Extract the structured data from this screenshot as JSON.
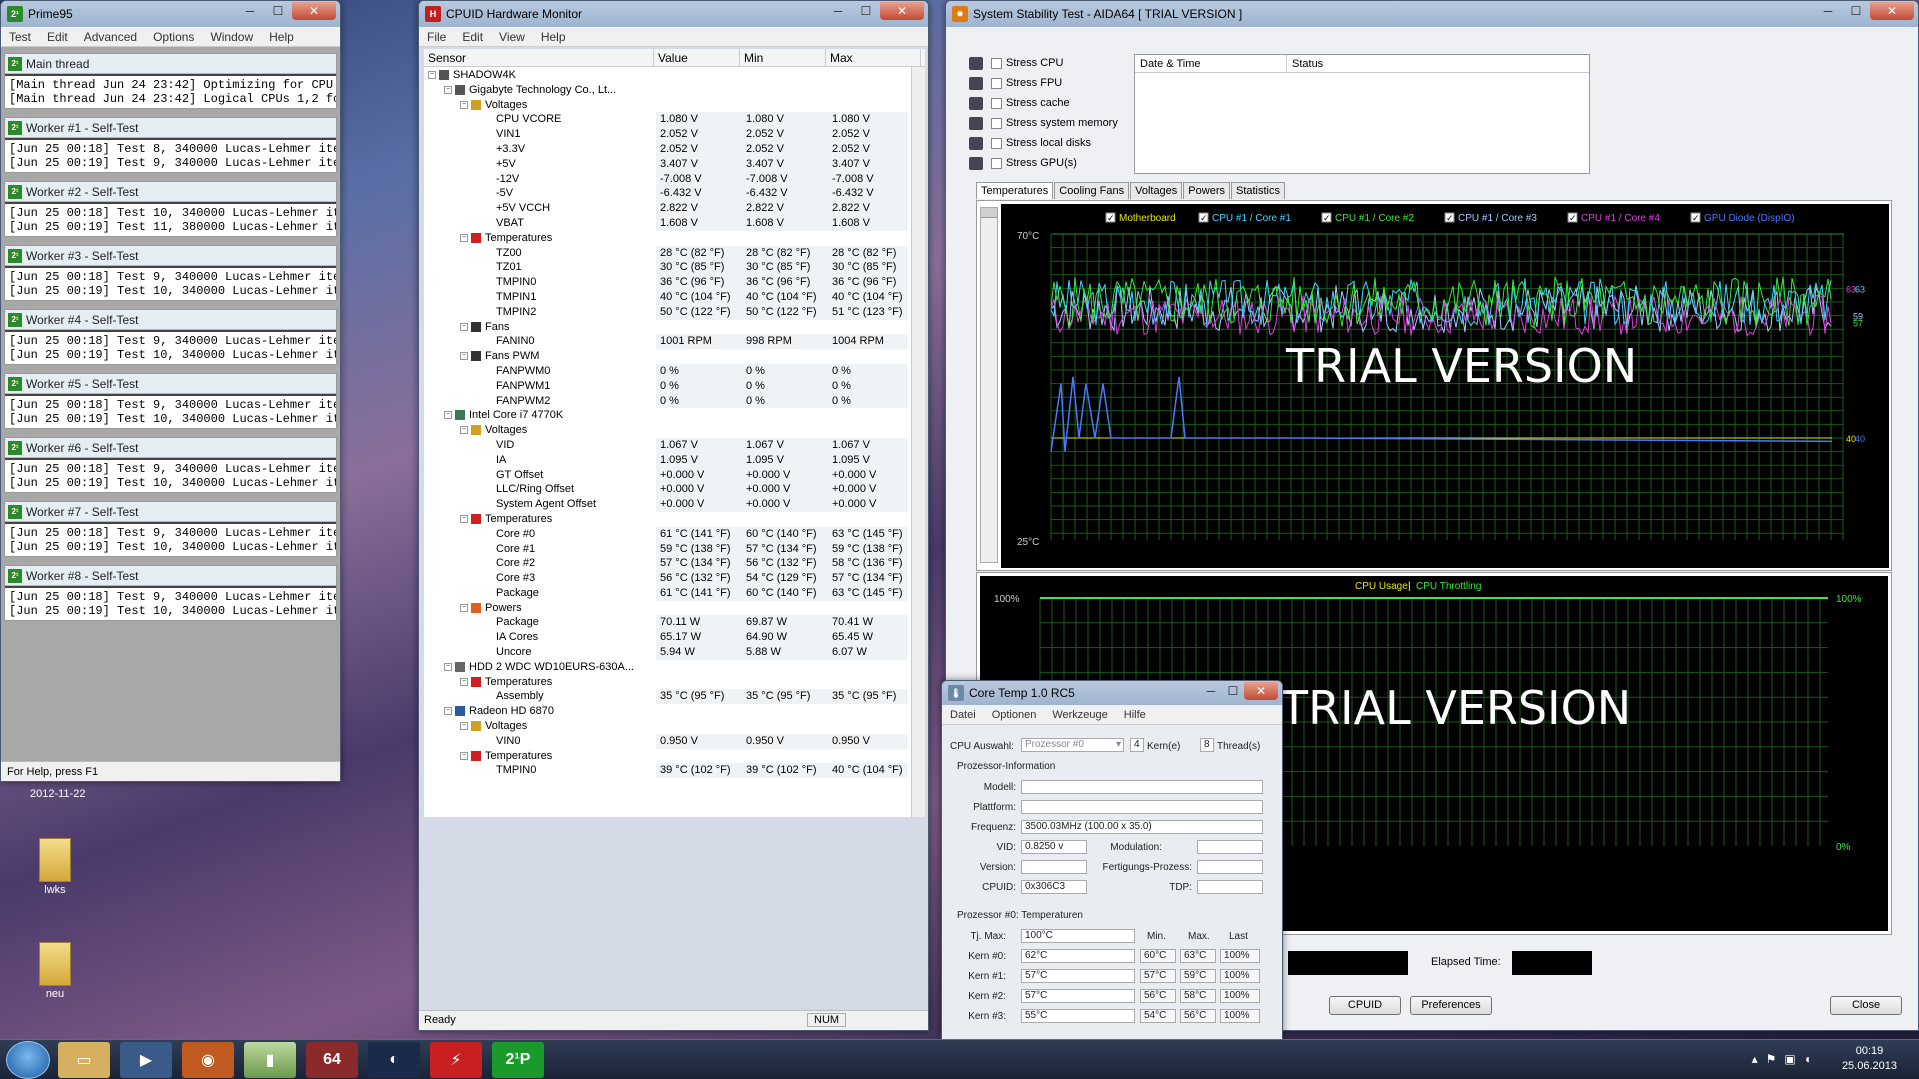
{
  "prime95": {
    "title": "Prime95",
    "menu": [
      "Test",
      "Edit",
      "Advanced",
      "Options",
      "Window",
      "Help"
    ],
    "main": {
      "title": "Main thread",
      "lines": [
        "[Main thread Jun 24 23:42] Optimizing for CPU architecture:",
        "[Main thread Jun 24 23:42] Logical CPUs 1,2 form one phys"
      ]
    },
    "workers": [
      {
        "title": "Worker #1 - Self-Test",
        "l1": "[Jun 25 00:18] Test 8, 340000 Lucas-Lehmer iterations of M",
        "l2": "[Jun 25 00:19] Test 9, 340000 Lucas-Lehmer iterations of M"
      },
      {
        "title": "Worker #2 - Self-Test",
        "l1": "[Jun 25 00:18] Test 10, 340000 Lucas-Lehmer iterations of",
        "l2": "[Jun 25 00:19] Test 11, 380000 Lucas-Lehmer iterations of"
      },
      {
        "title": "Worker #3 - Self-Test",
        "l1": "[Jun 25 00:18] Test 9, 340000 Lucas-Lehmer iterations of M",
        "l2": "[Jun 25 00:19] Test 10, 340000 Lucas-Lehmer iterations of"
      },
      {
        "title": "Worker #4 - Self-Test",
        "l1": "[Jun 25 00:18] Test 9, 340000 Lucas-Lehmer iterations of M",
        "l2": "[Jun 25 00:19] Test 10, 340000 Lucas-Lehmer iterations of"
      },
      {
        "title": "Worker #5 - Self-Test",
        "l1": "[Jun 25 00:18] Test 9, 340000 Lucas-Lehmer iterations of M",
        "l2": "[Jun 25 00:19] Test 10, 340000 Lucas-Lehmer iterations of"
      },
      {
        "title": "Worker #6 - Self-Test",
        "l1": "[Jun 25 00:18] Test 9, 340000 Lucas-Lehmer iterations of M",
        "l2": "[Jun 25 00:19] Test 10, 340000 Lucas-Lehmer iterations of"
      },
      {
        "title": "Worker #7 - Self-Test",
        "l1": "[Jun 25 00:18] Test 9, 340000 Lucas-Lehmer iterations of M",
        "l2": "[Jun 25 00:19] Test 10, 340000 Lucas-Lehmer iterations of"
      },
      {
        "title": "Worker #8 - Self-Test",
        "l1": "[Jun 25 00:18] Test 9, 340000 Lucas-Lehmer iterations of M",
        "l2": "[Jun 25 00:19] Test 10, 340000 Lucas-Lehmer iterations of"
      }
    ],
    "status": "For Help, press F1"
  },
  "hwmon": {
    "title": "CPUID Hardware Monitor",
    "menu": [
      "File",
      "Edit",
      "View",
      "Help"
    ],
    "columns": [
      "Sensor",
      "Value",
      "Min",
      "Max"
    ],
    "rows": [
      {
        "lv": 0,
        "t": "dev",
        "n": "SHADOW4K"
      },
      {
        "lv": 1,
        "t": "dev",
        "n": "Gigabyte Technology Co., Lt..."
      },
      {
        "lv": 2,
        "t": "volt",
        "n": "Voltages"
      },
      {
        "lv": 3,
        "n": "CPU VCORE",
        "v": "1.080 V",
        "mi": "1.080 V",
        "ma": "1.080 V"
      },
      {
        "lv": 3,
        "n": "VIN1",
        "v": "2.052 V",
        "mi": "2.052 V",
        "ma": "2.052 V"
      },
      {
        "lv": 3,
        "n": "+3.3V",
        "v": "2.052 V",
        "mi": "2.052 V",
        "ma": "2.052 V"
      },
      {
        "lv": 3,
        "n": "+5V",
        "v": "3.407 V",
        "mi": "3.407 V",
        "ma": "3.407 V"
      },
      {
        "lv": 3,
        "n": "-12V",
        "v": "-7.008 V",
        "mi": "-7.008 V",
        "ma": "-7.008 V"
      },
      {
        "lv": 3,
        "n": "-5V",
        "v": "-6.432 V",
        "mi": "-6.432 V",
        "ma": "-6.432 V"
      },
      {
        "lv": 3,
        "n": "+5V VCCH",
        "v": "2.822 V",
        "mi": "2.822 V",
        "ma": "2.822 V"
      },
      {
        "lv": 3,
        "n": "VBAT",
        "v": "1.608 V",
        "mi": "1.608 V",
        "ma": "1.608 V"
      },
      {
        "lv": 2,
        "t": "temp",
        "n": "Temperatures"
      },
      {
        "lv": 3,
        "n": "TZ00",
        "v": "28 °C (82 °F)",
        "mi": "28 °C (82 °F)",
        "ma": "28 °C (82 °F)"
      },
      {
        "lv": 3,
        "n": "TZ01",
        "v": "30 °C (85 °F)",
        "mi": "30 °C (85 °F)",
        "ma": "30 °C (85 °F)"
      },
      {
        "lv": 3,
        "n": "TMPIN0",
        "v": "36 °C (96 °F)",
        "mi": "36 °C (96 °F)",
        "ma": "36 °C (96 °F)"
      },
      {
        "lv": 3,
        "n": "TMPIN1",
        "v": "40 °C (104 °F)",
        "mi": "40 °C (104 °F)",
        "ma": "40 °C (104 °F)"
      },
      {
        "lv": 3,
        "n": "TMPIN2",
        "v": "50 °C (122 °F)",
        "mi": "50 °C (122 °F)",
        "ma": "51 °C (123 °F)"
      },
      {
        "lv": 2,
        "t": "fan",
        "n": "Fans"
      },
      {
        "lv": 3,
        "n": "FANIN0",
        "v": "1001 RPM",
        "mi": "998 RPM",
        "ma": "1004 RPM"
      },
      {
        "lv": 2,
        "t": "fan",
        "n": "Fans PWM"
      },
      {
        "lv": 3,
        "n": "FANPWM0",
        "v": "0 %",
        "mi": "0 %",
        "ma": "0 %"
      },
      {
        "lv": 3,
        "n": "FANPWM1",
        "v": "0 %",
        "mi": "0 %",
        "ma": "0 %"
      },
      {
        "lv": 3,
        "n": "FANPWM2",
        "v": "0 %",
        "mi": "0 %",
        "ma": "0 %"
      },
      {
        "lv": 1,
        "t": "chip",
        "n": "Intel Core i7 4770K"
      },
      {
        "lv": 2,
        "t": "volt",
        "n": "Voltages"
      },
      {
        "lv": 3,
        "n": "VID",
        "v": "1.067 V",
        "mi": "1.067 V",
        "ma": "1.067 V"
      },
      {
        "lv": 3,
        "n": "IA",
        "v": "1.095 V",
        "mi": "1.095 V",
        "ma": "1.095 V"
      },
      {
        "lv": 3,
        "n": "GT Offset",
        "v": "+0.000 V",
        "mi": "+0.000 V",
        "ma": "+0.000 V"
      },
      {
        "lv": 3,
        "n": "LLC/Ring Offset",
        "v": "+0.000 V",
        "mi": "+0.000 V",
        "ma": "+0.000 V"
      },
      {
        "lv": 3,
        "n": "System Agent Offset",
        "v": "+0.000 V",
        "mi": "+0.000 V",
        "ma": "+0.000 V"
      },
      {
        "lv": 2,
        "t": "temp",
        "n": "Temperatures"
      },
      {
        "lv": 3,
        "n": "Core #0",
        "v": "61 °C (141 °F)",
        "mi": "60 °C (140 °F)",
        "ma": "63 °C (145 °F)"
      },
      {
        "lv": 3,
        "n": "Core #1",
        "v": "59 °C (138 °F)",
        "mi": "57 °C (134 °F)",
        "ma": "59 °C (138 °F)"
      },
      {
        "lv": 3,
        "n": "Core #2",
        "v": "57 °C (134 °F)",
        "mi": "56 °C (132 °F)",
        "ma": "58 °C (136 °F)"
      },
      {
        "lv": 3,
        "n": "Core #3",
        "v": "56 °C (132 °F)",
        "mi": "54 °C (129 °F)",
        "ma": "57 °C (134 °F)"
      },
      {
        "lv": 3,
        "n": "Package",
        "v": "61 °C (141 °F)",
        "mi": "60 °C (140 °F)",
        "ma": "63 °C (145 °F)"
      },
      {
        "lv": 2,
        "t": "power",
        "n": "Powers"
      },
      {
        "lv": 3,
        "n": "Package",
        "v": "70.11 W",
        "mi": "69.87 W",
        "ma": "70.41 W"
      },
      {
        "lv": 3,
        "n": "IA Cores",
        "v": "65.17 W",
        "mi": "64.90 W",
        "ma": "65.45 W"
      },
      {
        "lv": 3,
        "n": "Uncore",
        "v": "5.94 W",
        "mi": "5.88 W",
        "ma": "6.07 W"
      },
      {
        "lv": 1,
        "t": "hdd",
        "n": "HDD 2 WDC WD10EURS-630A..."
      },
      {
        "lv": 2,
        "t": "temp",
        "n": "Temperatures"
      },
      {
        "lv": 3,
        "n": "Assembly",
        "v": "35 °C (95 °F)",
        "mi": "35 °C (95 °F)",
        "ma": "35 °C (95 °F)"
      },
      {
        "lv": 1,
        "t": "gpu",
        "n": "Radeon HD 6870"
      },
      {
        "lv": 2,
        "t": "volt",
        "n": "Voltages"
      },
      {
        "lv": 3,
        "n": "VIN0",
        "v": "0.950 V",
        "mi": "0.950 V",
        "ma": "0.950 V"
      },
      {
        "lv": 2,
        "t": "temp",
        "n": "Temperatures"
      },
      {
        "lv": 3,
        "n": "TMPIN0",
        "v": "39 °C (102 °F)",
        "mi": "39 °C (102 °F)",
        "ma": "40 °C (104 °F)"
      }
    ],
    "status": "Ready",
    "num": "NUM"
  },
  "aida": {
    "title": "System Stability Test - AIDA64  [ TRIAL VERSION ]",
    "stress": [
      "Stress CPU",
      "Stress FPU",
      "Stress cache",
      "Stress system memory",
      "Stress local disks",
      "Stress GPU(s)"
    ],
    "log_cols": [
      "Date & Time",
      "Status"
    ],
    "tabs": [
      "Temperatures",
      "Cooling Fans",
      "Voltages",
      "Powers",
      "Statistics"
    ],
    "legend": [
      {
        "name": "Motherboard",
        "color": "#e8e800"
      },
      {
        "name": "CPU #1 / Core #1",
        "color": "#48d2ff"
      },
      {
        "name": "CPU #1 / Core #2",
        "color": "#3ae83a"
      },
      {
        "name": "CPU #1 / Core #3",
        "color": "#a8c8ff"
      },
      {
        "name": "CPU #1 / Core #4",
        "color": "#e040e0"
      },
      {
        "name": "GPU Diode (DispIO)",
        "color": "#4a78ff"
      }
    ],
    "temp_top": "70°C",
    "temp_bottom": "25°C",
    "right_labels": [
      "63",
      "63",
      "59",
      "57",
      "40",
      "40"
    ],
    "watermark": "TRIAL VERSION",
    "usage_legend": [
      "CPU Usage",
      "CPU Throttling"
    ],
    "usage_sep": "|",
    "pct_top": "100%",
    "pct_bottom": "0%",
    "watermark2": "TRIAL VERSION",
    "elapsed_label": "Elapsed Time:",
    "buttons": [
      "CPUID",
      "Preferences",
      "Close"
    ]
  },
  "coretemp": {
    "title": "Core Temp 1.0 RC5",
    "menu": [
      "Datei",
      "Optionen",
      "Werkzeuge",
      "Hilfe"
    ],
    "cpu_sel_label": "CPU Auswahl:",
    "cpu_sel": "Prozessor #0",
    "cores": "4",
    "cores_label": "Kern(e)",
    "threads": "8",
    "threads_label": "Thread(s)",
    "info_title": "Prozessor-Information",
    "model_label": "Modell:",
    "platform_label": "Plattform:",
    "freq_label": "Frequenz:",
    "freq": "3500.03MHz (100.00 x 35.0)",
    "vid_label": "VID:",
    "vid": "0.8250 v",
    "modulation_label": "Modulation:",
    "version_label": "Version:",
    "fert_label": "Fertigungs-Prozess:",
    "cpuid_label": "CPUID:",
    "cpuid": "0x306C3",
    "tdp_label": "TDP:",
    "temp_title": "Prozessor #0: Temperaturen",
    "tjmax_label": "Tj. Max:",
    "tjmax": "100°C",
    "cols": [
      "Min.",
      "Max.",
      "Last"
    ],
    "cores_rows": [
      {
        "l": "Kern #0:",
        "t": "62°C",
        "mi": "60°C",
        "ma": "63°C",
        "ld": "100%"
      },
      {
        "l": "Kern #1:",
        "t": "57°C",
        "mi": "57°C",
        "ma": "59°C",
        "ld": "100%"
      },
      {
        "l": "Kern #2:",
        "t": "57°C",
        "mi": "56°C",
        "ma": "58°C",
        "ld": "100%"
      },
      {
        "l": "Kern #3:",
        "t": "55°C",
        "mi": "54°C",
        "ma": "56°C",
        "ld": "100%"
      }
    ]
  },
  "desktop": {
    "date_label": "2012-11-22",
    "icons": [
      "lwks",
      "neu"
    ]
  },
  "taskbar": {
    "time": "00:19",
    "date": "25.06.2013",
    "apps": [
      "start-orb",
      "file-explorer",
      "media-player",
      "firefox",
      "hwmonitor",
      "aida64",
      "cpuid",
      "flash",
      "prime95"
    ],
    "app_labels": [
      "64",
      "2¹P"
    ]
  }
}
